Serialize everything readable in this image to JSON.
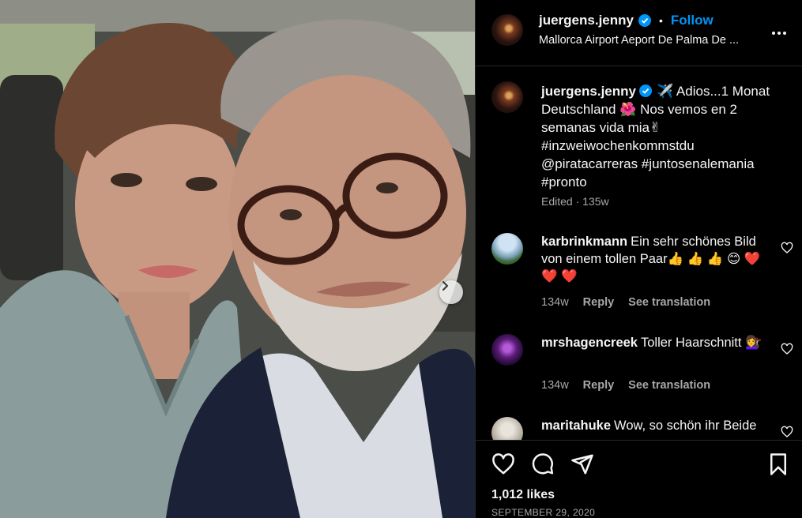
{
  "post": {
    "photo_alt": "",
    "next_label": "›"
  },
  "header": {
    "username": "juergens.jenny",
    "separator": "•",
    "follow_label": "Follow",
    "location": "Mallorca Airport Aeport De Palma De ..."
  },
  "caption": {
    "username": "juergens.jenny",
    "text": "✈️ Adios...1 Monat Deutschland 🌺 Nos vemos en 2 semanas vida mia✌ #inzweiwochenkommstdu @piratacarreras #juntosenalemania #pronto",
    "meta": "Edited · 135w"
  },
  "comments": [
    {
      "username": "karbrinkmann",
      "text": "Ein sehr schönes Bild von einem tollen Paar👍 👍 👍 😊 ❤️ ❤️ ❤️",
      "time": "134w",
      "reply_label": "Reply",
      "translate_label": "See translation"
    },
    {
      "username": "mrshagencreek",
      "text": "Toller Haarschnitt 💇‍♀️",
      "time": "134w",
      "reply_label": "Reply",
      "translate_label": "See translation"
    },
    {
      "username": "maritahuke",
      "text": "Wow, so schön ihr Beide",
      "time": "",
      "reply_label": "",
      "translate_label": ""
    }
  ],
  "footer": {
    "likes": "1,012 likes",
    "date": "SEPTEMBER 29, 2020"
  },
  "icons": {
    "like": "heart-icon",
    "comment": "comment-icon",
    "share": "share-icon",
    "save": "bookmark-icon",
    "more": "more-icon",
    "verified": "verified-badge-icon",
    "next": "chevron-right-icon"
  },
  "colors": {
    "background": "#000000",
    "text": "#f5f5f5",
    "secondary": "#a8a8a8",
    "accent": "#0095f6",
    "divider": "#262626"
  }
}
